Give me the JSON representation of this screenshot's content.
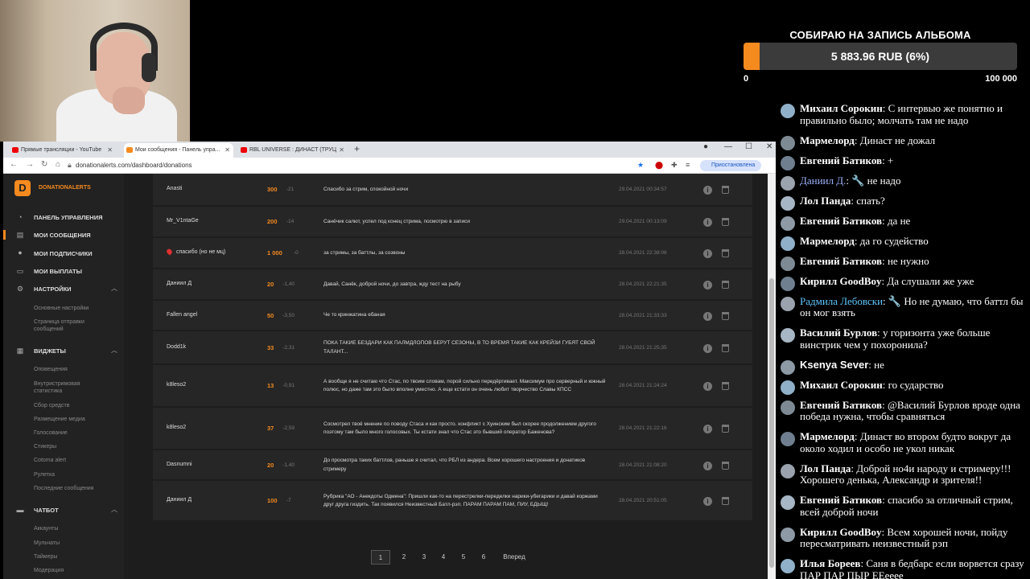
{
  "goal": {
    "title": "СОБИРАЮ НА ЗАПИСЬ АЛЬБОМА",
    "progress_text": "5 883.96 RUB (6%)",
    "progress_fraction": 0.06,
    "min": "0",
    "max": "100 000"
  },
  "browser": {
    "tabs": [
      {
        "label": "Прямые трансляции - YouTube",
        "icon": "youtube-icon"
      },
      {
        "label": "Мои сообщения - Панель упра...",
        "icon": "donationalerts-icon",
        "active": true
      },
      {
        "label": "RBL UNIVERSE : ДИНАСТ (ТРУЦ",
        "icon": "youtube-icon"
      }
    ],
    "url": "donationalerts.com/dashboard/donations",
    "profile_label": "Приостановлена"
  },
  "sidebar": {
    "logo": "DONATIONALERTS",
    "main": [
      {
        "label": "ПАНЕЛЬ УПРАВЛЕНИЯ",
        "icon": "dashboard-icon"
      },
      {
        "label": "МОИ СООБЩЕНИЯ",
        "icon": "messages-icon"
      },
      {
        "label": "МОИ ПОДПИСЧИКИ",
        "icon": "user-icon"
      },
      {
        "label": "МОИ ВЫПЛАТЫ",
        "icon": "wallet-icon"
      },
      {
        "label": "НАСТРОЙКИ",
        "icon": "gear-icon"
      }
    ],
    "settings_sub": [
      "Основные настройки",
      "Страница отправки сообщений"
    ],
    "widgets_label": "ВИДЖЕТЫ",
    "widgets_sub": [
      "Оповещения",
      "Внутристримовая статистика",
      "Сбор средств",
      "Размещение медиа",
      "Голосование",
      "Стикеры",
      "Cotoma alert",
      "Рулетка",
      "Последние сообщения"
    ],
    "chatbot_label": "ЧАТБОТ",
    "chatbot_sub": [
      "Аккаунты",
      "Мульчаты",
      "Таймеры",
      "Модерация"
    ]
  },
  "donations": [
    {
      "name": "Anasti",
      "amount": "300",
      "fee": "-21",
      "message": "Спасибо за стрим, спокойной ночи",
      "date": "29.04.2021 00:34:57"
    },
    {
      "name": "Mr_V1ntaGe",
      "amount": "200",
      "fee": "-14",
      "message": "Санёчик салют, успел под конец стрима, посмотрю в записи",
      "date": "29.04.2021 00:13:09"
    },
    {
      "name": "спасибо (но не мц)",
      "amount": "1 000",
      "fee": "-0",
      "message": "за стримы, за баттлы, за созвоны",
      "date": "28.04.2021 22:38:06",
      "heart": true
    },
    {
      "name": "Даниил Д",
      "amount": "20",
      "fee": "-1,40",
      "message": "Давай, Санёк, доброй ночи, до завтра, жду тест на рыбу",
      "date": "28.04.2021 22:21:35"
    },
    {
      "name": "Fallen angel",
      "amount": "50",
      "fee": "-3,50",
      "message": "Че то кринжатина ебаная",
      "date": "28.04.2021 21:33:33"
    },
    {
      "name": "Dodd1k",
      "amount": "33",
      "fee": "-2,31",
      "message": "ПОКА ТАКИЕ БЕЗДАРИ КАК ПАЛМДЛОПОВ БЕРУТ СЕЗОНЫ, В ТО ВРЕМЯ ТАКИЕ КАК КРЕЙЗИ ГУБЯТ СВОЙ ТАЛАНТ...",
      "date": "28.04.2021 21:25:35"
    },
    {
      "name": "k8leso2",
      "amount": "13",
      "fee": "-0,91",
      "message": "А вообще я не считаю что Стас, по твоим словам, порой сильно передёргивает. Максимум про серверный и южный полюс, но даже там это было вполне уместно. А еще кстати он очень любит творчество Славы КПСС",
      "date": "28.04.2021 21:24:24"
    },
    {
      "name": "k8leso2",
      "amount": "37",
      "fee": "-2,59",
      "message": "Cосмотрел твоё мнение по поводу Стаса и как просто. конфликт с Хуинским был скорее продолжением другого поэтому там было много голосовых. Ты кстати знал что Стас это бывший оператор Баженова?",
      "date": "28.04.2021 21:22:16"
    },
    {
      "name": "Dasnumni",
      "amount": "20",
      "fee": "-1,40",
      "message": "До просмотра таких баттлов, раньше я считал, что РБЛ из андера. Всем хорошего настроения и донатиков стримеру",
      "date": "28.04.2021 21:08:20"
    },
    {
      "name": "Даниил Д",
      "amount": "100",
      "fee": "-7",
      "message": "Рубрика \"АО - Анекдоты Одмена\": Пришли как-то на перестрелки-переделки нарики-убегарики и давай коржами друг друга гиздить. Так появился Неизвестный Батл-рэп. ПАРАМ ПАРАМ ПАМ, ПИУ, БДЫЩ!",
      "date": "28.04.2021 20:51:05"
    }
  ],
  "pagination": [
    "1",
    "2",
    "3",
    "4",
    "5",
    "6",
    "Вперед"
  ],
  "chat": [
    {
      "name": "Михаил Сорокин",
      "text": ": С интервью же понятно и правильно было; молчать там не надо"
    },
    {
      "name": "Мармелорд",
      "text": ": Династ не дожал"
    },
    {
      "name": "Евгений Батиков",
      "text": ": +"
    },
    {
      "name": "Даниил Д.",
      "text": ": 🔧 не надо",
      "style": "blue"
    },
    {
      "name": "Лол Панда",
      "text": ": спать?"
    },
    {
      "name": "Евгений Батиков",
      "text": ": да не"
    },
    {
      "name": "Мармелорд",
      "text": ": да го судейство"
    },
    {
      "name": "Евгений Батиков",
      "text": ": не нужно"
    },
    {
      "name": "Кирилл GoodBoy",
      "text": ": Да слушали же уже"
    },
    {
      "name": "Радмила Лебовски",
      "text": ": 🔧 Но не думаю, что баттл бы он мог взять",
      "style": "cyan"
    },
    {
      "name": "Василий Бурлов",
      "text": ": у горизонта уже больше винстрик чем у похоронила?"
    },
    {
      "name": "Ksenya Sever",
      "text": ": не",
      "style": "sans"
    },
    {
      "name": "Михаил Сорокин",
      "text": ": го сударство"
    },
    {
      "name": "Евгений Батиков",
      "text": ": @Василий Бурлов вроде одна победа нужна, чтобы сравняться"
    },
    {
      "name": "Мармелорд",
      "text": ": Династ во втором будто вокруг да около ходил и особо не укол никак"
    },
    {
      "name": "Лол Панда",
      "text": ": Доброй но4и народу и стримеру!!! Хорошего денька, Александр и зрителя!!"
    },
    {
      "name": "Евгений Батиков",
      "text": ": спасибо за отличный стрим, всей доброй ночи"
    },
    {
      "name": "Кирилл GoodBoy",
      "text": ": Всем хорошей ночи, пойду пересматривать неизвестный рэп"
    },
    {
      "name": "Илья Бореев",
      "text": ": Саня в бедбарс если ворвется сразу ПАР ПАР ПЫР ЕЕееее"
    }
  ],
  "colors": {
    "accent": "#f58a1f",
    "bg": "#1d1d1d"
  }
}
